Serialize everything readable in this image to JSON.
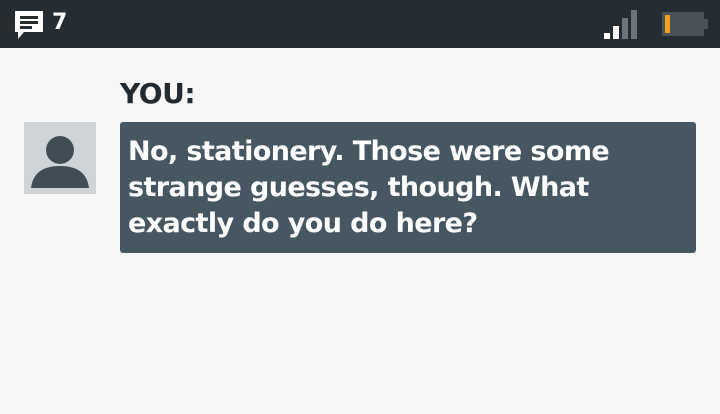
{
  "status_bar": {
    "notification_count": "7",
    "icons": {
      "notification": "chat-bubble-icon",
      "signal": "signal-strength-icon",
      "battery": "battery-low-icon"
    },
    "battery_level": 0.15,
    "colors": {
      "bar_background": "#252d33",
      "battery_fill": "#f0a020"
    }
  },
  "conversation": {
    "sender_label": "YOU:",
    "message": "No, stationery. Those were some strange guesses, though. What exactly do you do here?",
    "avatar_icon": "person-silhouette-icon",
    "colors": {
      "bubble": "#475761",
      "avatar_background": "#cfd4d8",
      "page_background": "#f7f7f7"
    }
  }
}
